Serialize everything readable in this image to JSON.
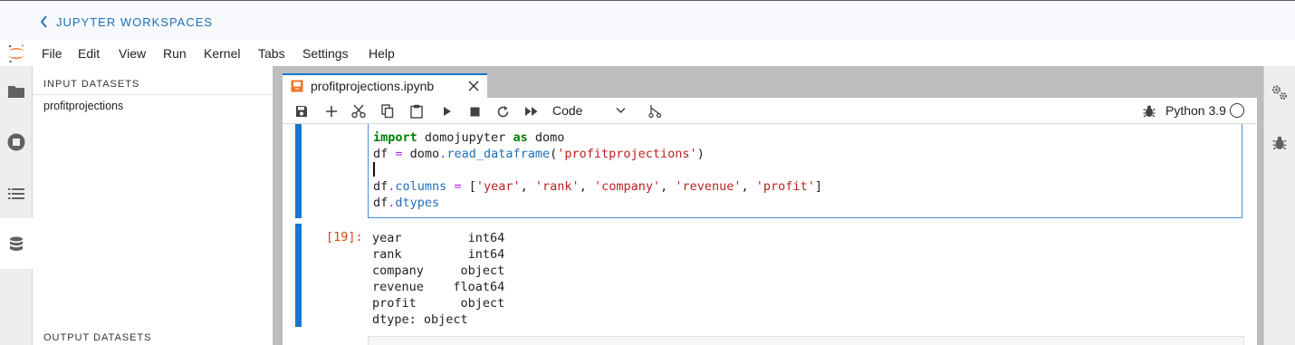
{
  "workspace_bar": {
    "back_label": "JUPYTER WORKSPACES"
  },
  "menu": {
    "items": [
      "File",
      "Edit",
      "View",
      "Run",
      "Kernel",
      "Tabs",
      "Settings",
      "Help"
    ]
  },
  "left_panel": {
    "input_title": "INPUT DATASETS",
    "input_items": [
      "profitprojections"
    ],
    "output_title": "OUTPUT DATASETS"
  },
  "tab": {
    "title": "profitprojections.ipynb"
  },
  "toolbar": {
    "cell_type": "Code",
    "kernel_name": "Python 3.9"
  },
  "cell": {
    "code_lines": [
      "import domojupyter as domo",
      "df = domo.read_dataframe('profitprojections')",
      "",
      "df.columns = ['year', 'rank', 'company', 'revenue', 'profit']",
      "df.dtypes"
    ],
    "output_prompt": "[19]:",
    "output_lines": [
      "year         int64",
      "rank         int64",
      "company     object",
      "revenue    float64",
      "profit      object",
      "dtype: object"
    ]
  },
  "colors": {
    "accent": "#1976d2",
    "prompt_out": "#d84315",
    "logo": "#f37626",
    "link": "#1f6fb7"
  },
  "icons": [
    "chevron-left-icon",
    "jupyter-logo",
    "folder-icon",
    "stop-icon",
    "list-icon",
    "database-icon",
    "notebook-icon",
    "close-icon",
    "save-icon",
    "plus-icon",
    "scissors-icon",
    "copy-icon",
    "paste-icon",
    "run-icon",
    "stop-icon",
    "restart-icon",
    "fast-forward-icon",
    "chevron-down-icon",
    "git-icon",
    "bug-icon",
    "circle-icon",
    "gears-icon"
  ]
}
